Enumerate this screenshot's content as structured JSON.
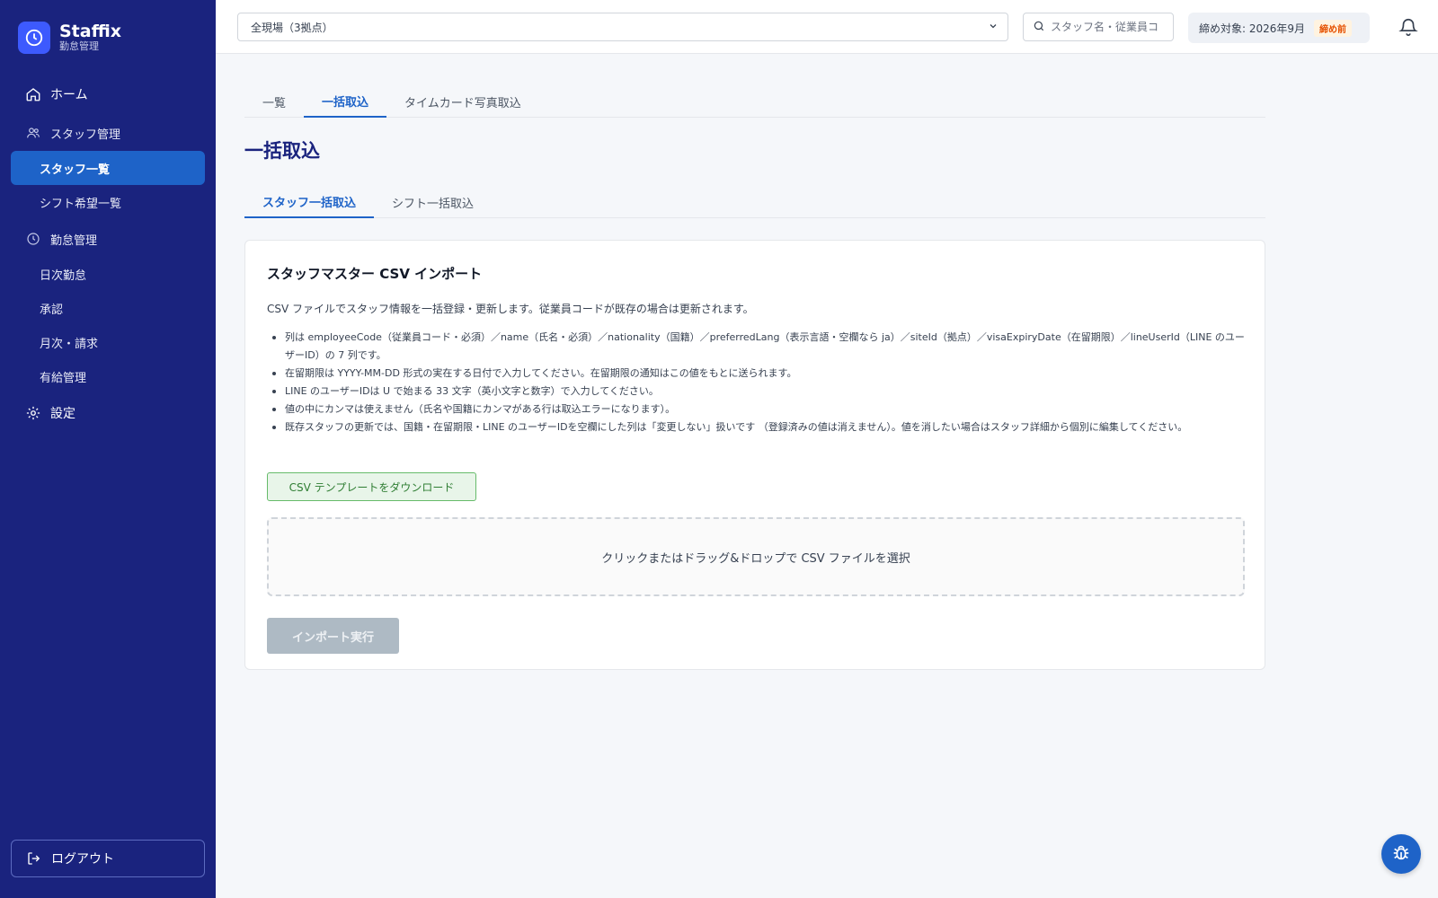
{
  "app": {
    "name": "Staffix",
    "subtitle": "勤怠管理",
    "accent": "#1a237e",
    "active_color": "#1e63c8"
  },
  "sidebar": {
    "home": {
      "label": "ホーム",
      "icon": "home-icon"
    },
    "staff_group": {
      "label": "スタッフ管理",
      "icon": "users-icon"
    },
    "staff_items": [
      {
        "label": "スタッフ一覧",
        "active": true
      },
      {
        "label": "シフト希望一覧",
        "active": false
      }
    ],
    "attendance_group": {
      "label": "勤怠管理",
      "icon": "clock-icon"
    },
    "attendance_items": [
      {
        "label": "日次勤怠"
      },
      {
        "label": "承認"
      },
      {
        "label": "月次・請求"
      },
      {
        "label": "有給管理"
      }
    ],
    "settings": {
      "label": "設定",
      "icon": "gear-icon"
    },
    "logout": {
      "label": "ログアウト",
      "icon": "logout-icon"
    }
  },
  "topbar": {
    "site_select": {
      "value": "全現場（3拠点）"
    },
    "search": {
      "placeholder": "スタッフ名・従業員コード"
    },
    "closing": {
      "label": "締め対象: 2026年9月",
      "badge": "締め前"
    }
  },
  "main": {
    "tabs": [
      {
        "label": "一覧",
        "active": false
      },
      {
        "label": "一括取込",
        "active": true
      },
      {
        "label": "タイムカード写真取込",
        "active": false
      }
    ],
    "title": "一括取込",
    "sub_tabs": [
      {
        "label": "スタッフ一括取込",
        "active": true
      },
      {
        "label": "シフト一括取込",
        "active": false
      }
    ],
    "card": {
      "title": "スタッフマスター CSV インポート",
      "description": "CSV ファイルでスタッフ情報を一括登録・更新します。従業員コードが既存の場合は更新されます。",
      "notes": [
        "列は employeeCode（従業員コード・必須）／name（氏名・必須）／nationality（国籍）／preferredLang（表示言語・空欄なら ja）／siteId（拠点）／visaExpiryDate（在留期限）／lineUserId（LINE のユーザーID）の 7 列です。",
        "在留期限は YYYY-MM-DD 形式の実在する日付で入力してください。在留期限の通知はこの値をもとに送られます。",
        "LINE のユーザーIDは U で始まる 33 文字（英小文字と数字）で入力してください。",
        "値の中にカンマは使えません（氏名や国籍にカンマがある行は取込エラーになります）。",
        "既存スタッフの更新では、国籍・在留期限・LINE のユーザーIDを空欄にした列は「変更しない」扱いです （登録済みの値は消えません）。値を消したい場合はスタッフ詳細から個別に編集してください。"
      ],
      "template_button": "CSV テンプレートをダウンロード",
      "dropzone_text": "クリックまたはドラッグ&ドロップで CSV ファイルを選択",
      "import_button": "インポート実行"
    }
  },
  "fab": {
    "icon": "bug-icon"
  }
}
